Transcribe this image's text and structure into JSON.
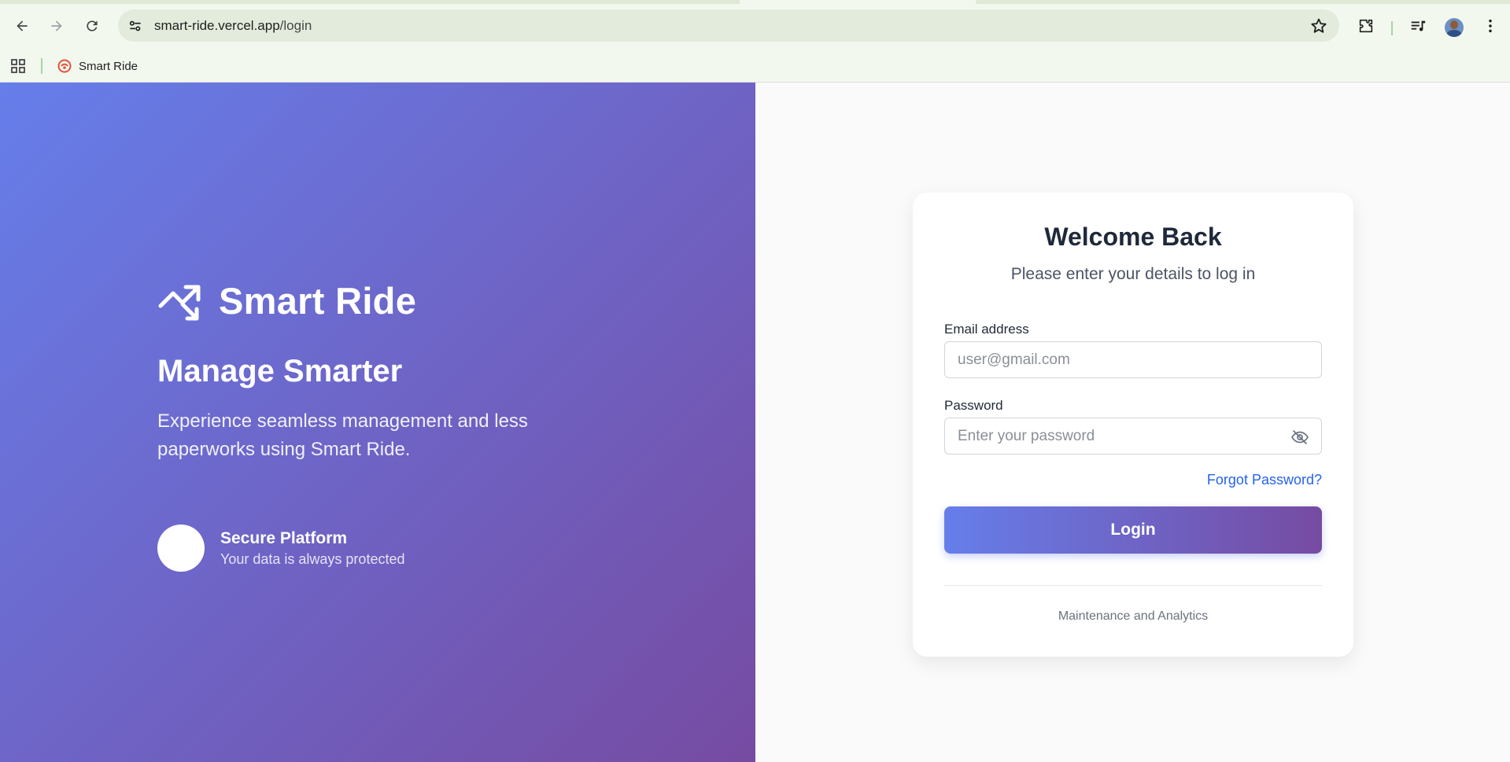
{
  "browser": {
    "url_host": "smart-ride.vercel.app",
    "url_path": "/login",
    "icons": {
      "back": "arrow-left-icon",
      "forward": "arrow-right-icon",
      "reload": "reload-icon",
      "site_info": "tune-icon",
      "bookmark_star": "star-icon",
      "extensions": "puzzle-icon",
      "media": "media-queue-icon",
      "profile": "avatar",
      "menu": "more-vertical-icon"
    },
    "bookmarks_bar": {
      "apps_icon": "apps-grid-icon",
      "items": [
        {
          "label": "Smart Ride",
          "icon": "site-favicon"
        }
      ]
    }
  },
  "hero": {
    "brand_name": "Smart Ride",
    "brand_icon": "trending-up-icon",
    "tagline": "Manage Smarter",
    "description": "Experience seamless management and less paperworks using Smart Ride.",
    "feature": {
      "title": "Secure Platform",
      "subtitle": "Your data is always protected"
    },
    "gradient_start": "#667eea",
    "gradient_end": "#764ba2"
  },
  "login": {
    "title": "Welcome Back",
    "subtitle": "Please enter your details to log in",
    "email_label": "Email address",
    "email_placeholder": "user@gmail.com",
    "email_value": "",
    "password_label": "Password",
    "password_placeholder": "Enter your password",
    "password_value": "",
    "password_toggle_icon": "eye-off-icon",
    "forgot_label": "Forgot Password?",
    "submit_label": "Login",
    "footer": "Maintenance and Analytics",
    "link_color": "#2563eb"
  }
}
